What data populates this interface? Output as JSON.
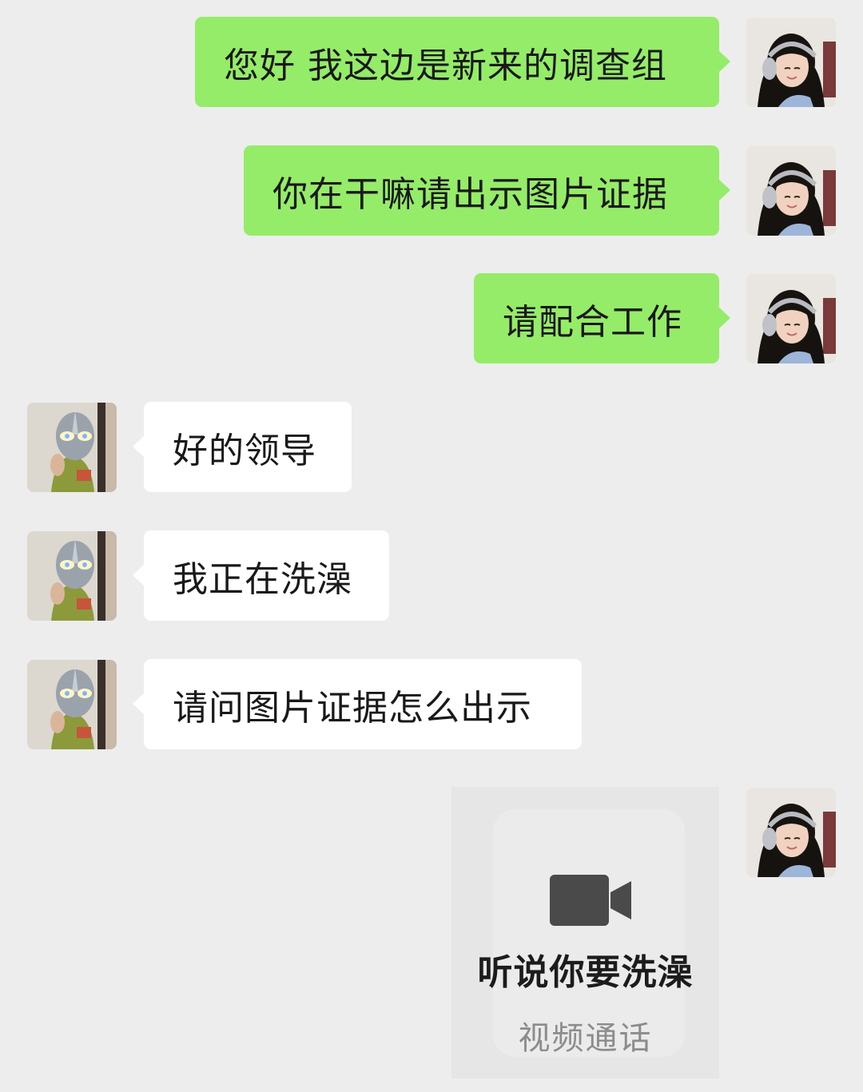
{
  "chat": {
    "messages": [
      {
        "side": "out",
        "text": "您好 我这边是新来的调查组"
      },
      {
        "side": "out",
        "text": "你在干嘛请出示图片证据"
      },
      {
        "side": "out",
        "text": "请配合工作"
      },
      {
        "side": "in",
        "text": "好的领导"
      },
      {
        "side": "in",
        "text": "我正在洗澡"
      },
      {
        "side": "in",
        "text": "请问图片证据怎么出示"
      }
    ],
    "video_card": {
      "title": "听说你要洗澡",
      "subtitle": "视频通话",
      "icon": "video-camera-icon"
    }
  },
  "avatars": {
    "self": "girl-with-headphones-avatar",
    "other": "ultraman-mask-avatar"
  },
  "colors": {
    "background": "#ededed",
    "outgoing_bubble": "#95ec69",
    "incoming_bubble": "#ffffff",
    "text": "#191919"
  }
}
